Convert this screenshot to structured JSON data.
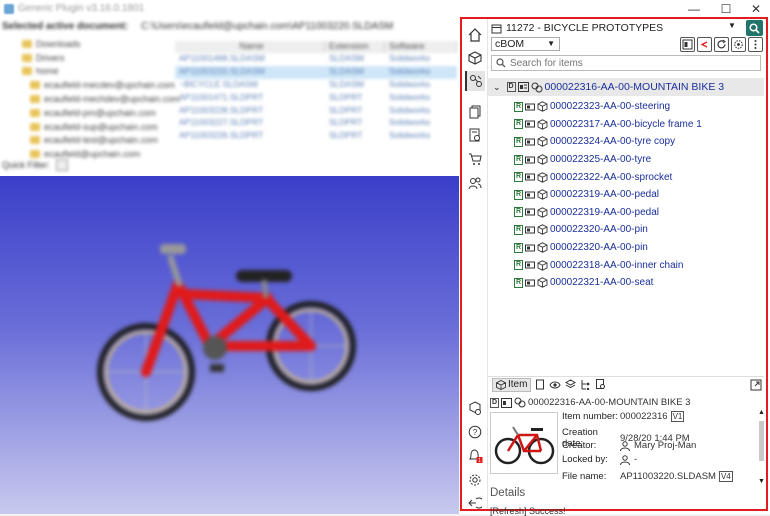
{
  "window": {
    "title": "Generic Plugin v3.16.0.1801",
    "minimize": "—",
    "maximize": "☐",
    "close": "✕"
  },
  "left": {
    "active_doc_label": "Selected active document:",
    "active_doc_path": "C:\\Users\\ecaufield@upchain.com\\AP11003220.SLDASM",
    "tree": [
      "Downloads",
      "Drivers",
      "home",
      "ecaufield-mecdev@upchain.com",
      "ecaufield-mechdev@upchain.com",
      "ecaufield-pm@upchain.com",
      "ecaufield-sup@upchain.com",
      "ecaufield-test@upchain.com",
      "ecaufield@upchain.com"
    ],
    "file_headers": [
      "Name",
      "Extension",
      "Software"
    ],
    "files": [
      [
        "AP11001468.SLDASM",
        "SLDASM",
        "Solidworks"
      ],
      [
        "AP11003220.SLDASM",
        "SLDASM",
        "Solidworks"
      ],
      [
        "~BICYCLE.SLDASM",
        "SLDASM",
        "Solidworks"
      ],
      [
        "AP11001471.SLDPRT",
        "SLDPRT",
        "Solidworks"
      ],
      [
        "AP11003228.SLDPRT",
        "SLDPRT",
        "Solidworks"
      ],
      [
        "AP11003227.SLDPRT",
        "SLDPRT",
        "Solidworks"
      ],
      [
        "AP11003226.SLDPRT",
        "SLDPRT",
        "Solidworks"
      ]
    ],
    "quick_filter": "Quick Filter:"
  },
  "panel": {
    "project": "11272 - BICYCLE PROTOTYPES",
    "bom_type": "cBOM",
    "search_placeholder": "Search for items",
    "root": {
      "status": "D",
      "label": "000022316-AA-00-MOUNTAIN BIKE 3"
    },
    "children": [
      "000022323-AA-00-steering",
      "000022317-AA-00-bicycle frame 1",
      "000022324-AA-00-tyre copy",
      "000022325-AA-00-tyre",
      "000022322-AA-00-sprocket",
      "000022319-AA-00-pedal",
      "000022319-AA-00-pedal",
      "000022320-AA-00-pin",
      "000022320-AA-00-pin",
      "000022318-AA-00-inner chain",
      "000022321-AA-00-seat"
    ],
    "released_badge": "R",
    "detail_tab": "Item",
    "detail_title": "000022316-AA-00-MOUNTAIN BIKE 3",
    "props": {
      "item_number_label": "Item number:",
      "item_number": "000022316",
      "item_version": "V1",
      "creation_label": "Creation date:",
      "creation": "9/28/20 1:44 PM",
      "creator_label": "Creator:",
      "creator": "Mary Proj-Man",
      "locked_label": "Locked by:",
      "locked": "-",
      "file_label": "File name:",
      "file": "AP11003220.SLDASM",
      "file_version": "V4"
    },
    "details_heading": "Details",
    "status": "[Refresh] Success!",
    "colors": {
      "accent": "#21756a",
      "highlight_border": "#e11d1d",
      "link": "#1a2f9a"
    }
  }
}
